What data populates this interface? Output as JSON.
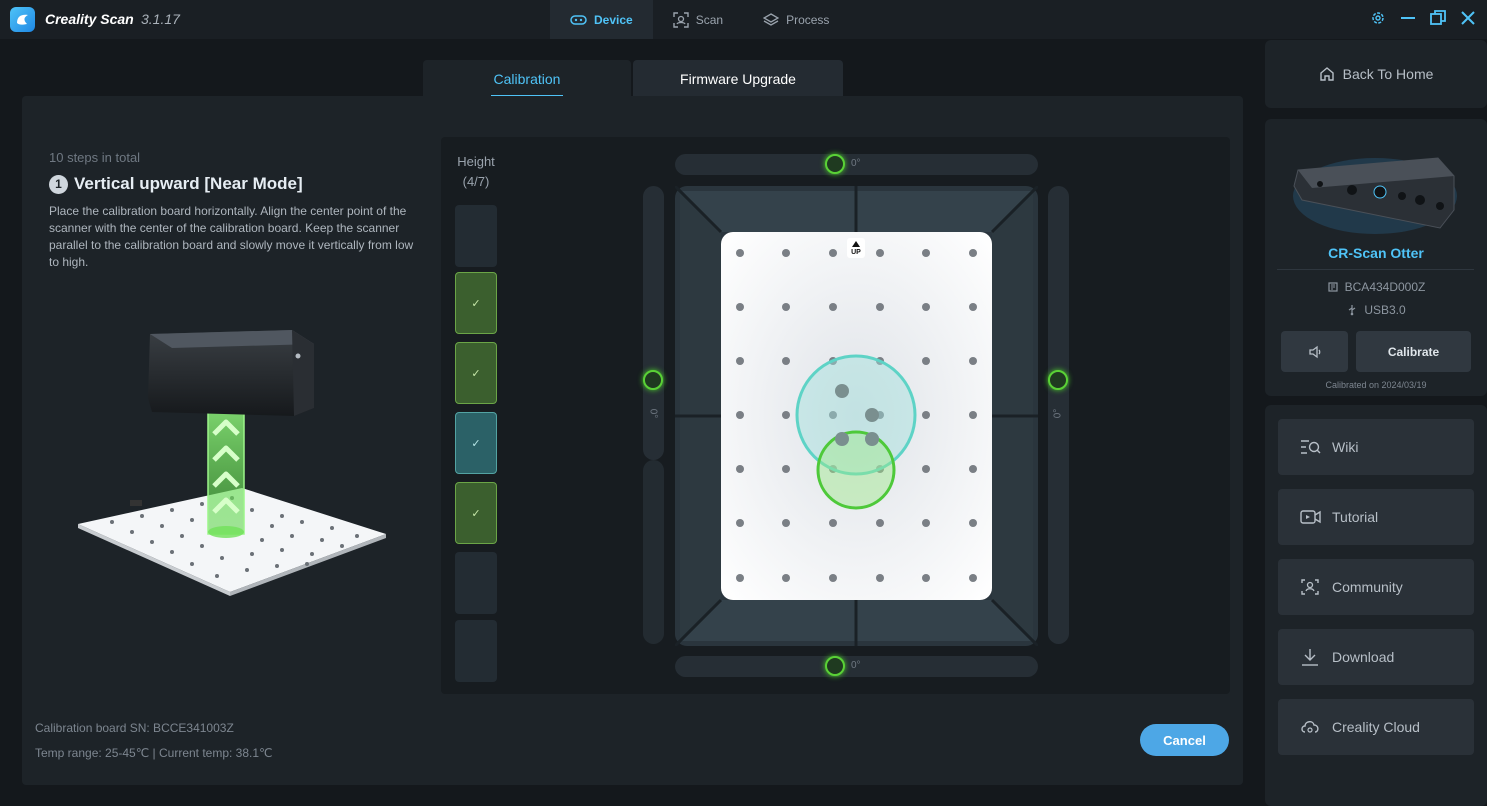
{
  "app": {
    "name": "Creality Scan",
    "version": "3.1.17"
  },
  "topnav": [
    {
      "label": "Device",
      "icon": "device-icon",
      "active": true
    },
    {
      "label": "Scan",
      "icon": "scan-icon",
      "active": false
    },
    {
      "label": "Process",
      "icon": "layers-icon",
      "active": false
    }
  ],
  "subtabs": {
    "calibration": "Calibration",
    "firmware": "Firmware Upgrade"
  },
  "step": {
    "total": "10 steps in total",
    "number": "1",
    "title": "Vertical upward [Near Mode]",
    "description": "Place the calibration board horizontally. Align the center point of the scanner with the center of the calibration board. Keep the scanner parallel to the calibration board and slowly move it vertically from low to high."
  },
  "height": {
    "label": "Height",
    "progress": "(4/7)",
    "total": 7,
    "completed": 4,
    "check": "✓"
  },
  "board": {
    "up_label": "UP"
  },
  "angles": {
    "top": "0°",
    "bottom": "0°",
    "left": "0°",
    "right": "0°"
  },
  "footer": {
    "board_sn": "Calibration board SN:  BCCE341003Z",
    "temp": "Temp range: 25-45℃  |  Current temp: 38.1℃"
  },
  "cancel_label": "Cancel",
  "sidebar": {
    "home": "Back To Home",
    "device_name": "CR-Scan Otter",
    "serial": "BCA434D000Z",
    "usb": "USB3.0",
    "calibrate": "Calibrate",
    "calibrated_on": "Calibrated on 2024/03/19",
    "links": [
      {
        "label": "Wiki",
        "icon": "wiki-search-icon"
      },
      {
        "label": "Tutorial",
        "icon": "video-icon"
      },
      {
        "label": "Community",
        "icon": "community-icon"
      },
      {
        "label": "Download",
        "icon": "download-icon"
      },
      {
        "label": "Creality Cloud",
        "icon": "cloud-icon"
      }
    ]
  },
  "colors": {
    "accent": "#4fc3f7",
    "ring": "#5ad136",
    "cancel": "#4da7e6"
  }
}
